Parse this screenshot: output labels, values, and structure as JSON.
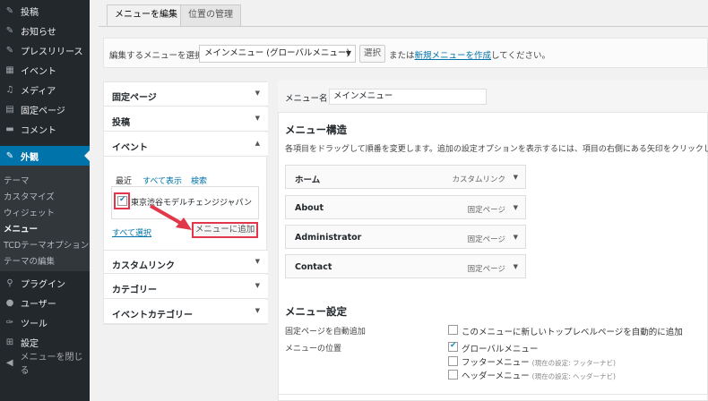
{
  "sidebar": {
    "items": [
      {
        "label": "投稿",
        "icon": "pin-icon"
      },
      {
        "label": "お知らせ",
        "icon": "pin-icon"
      },
      {
        "label": "プレスリリース",
        "icon": "pin-icon"
      },
      {
        "label": "イベント",
        "icon": "calendar-icon"
      },
      {
        "label": "メディア",
        "icon": "media-icon"
      },
      {
        "label": "固定ページ",
        "icon": "page-icon"
      },
      {
        "label": "コメント",
        "icon": "comment-icon"
      },
      {
        "label": "外観",
        "icon": "brush-icon"
      },
      {
        "label": "プラグイン",
        "icon": "plugin-icon"
      },
      {
        "label": "ユーザー",
        "icon": "user-icon"
      },
      {
        "label": "ツール",
        "icon": "wrench-icon"
      },
      {
        "label": "設定",
        "icon": "settings-icon"
      },
      {
        "label": "メニューを閉じる",
        "icon": "collapse-icon"
      }
    ],
    "submenu": [
      "テーマ",
      "カスタマイズ",
      "ウィジェット",
      "メニュー",
      "TCDテーマオプション",
      "テーマの編集"
    ]
  },
  "tabs": [
    "メニューを編集",
    "位置の管理"
  ],
  "manage": {
    "label": "編集するメニューを選択:",
    "selected": "メインメニュー (グローバルメニュー)",
    "select_btn": "選択",
    "or_text": "または",
    "new_link": "新規メニューを作成",
    "tail": "してください。"
  },
  "left_panel": {
    "sections": [
      "固定ページ",
      "投稿",
      "イベント",
      "カスタムリンク",
      "カテゴリー",
      "イベントカテゴリー"
    ],
    "inner_tabs": [
      "最近",
      "すべて表示",
      "検索"
    ],
    "event_item": "東京渋谷モデルチェンジジャパン",
    "select_all": "すべて選択",
    "add_btn": "メニューに追加"
  },
  "right_panel": {
    "name_label": "メニュー名",
    "name_value": "メインメニュー",
    "structure_title": "メニュー構造",
    "structure_desc": "各項目をドラッグして順番を変更します。追加の設定オプションを表示するには、項目の右側にある矢印をクリックします。",
    "entries": [
      {
        "title": "ホーム",
        "type": "カスタムリンク"
      },
      {
        "title": "About",
        "type": "固定ページ"
      },
      {
        "title": "Administrator",
        "type": "固定ページ"
      },
      {
        "title": "Contact",
        "type": "固定ページ"
      }
    ],
    "settings_title": "メニュー設定",
    "auto_add_label": "固定ページを自動追加",
    "auto_add_option": "このメニューに新しいトップレベルページを自動的に追加",
    "location_label": "メニューの位置",
    "locations": [
      {
        "name": "グローバルメニュー",
        "note": "",
        "checked": true
      },
      {
        "name": "フッターメニュー",
        "note": "(現在の設定: フッターナビ)",
        "checked": false
      },
      {
        "name": "ヘッダーメニュー",
        "note": "(現在の設定: ヘッダーナビ)",
        "checked": false
      }
    ]
  },
  "colors": {
    "sidebar": "#23282d",
    "active": "#0073aa",
    "highlight": "#e2374a",
    "link": "#0073aa"
  }
}
